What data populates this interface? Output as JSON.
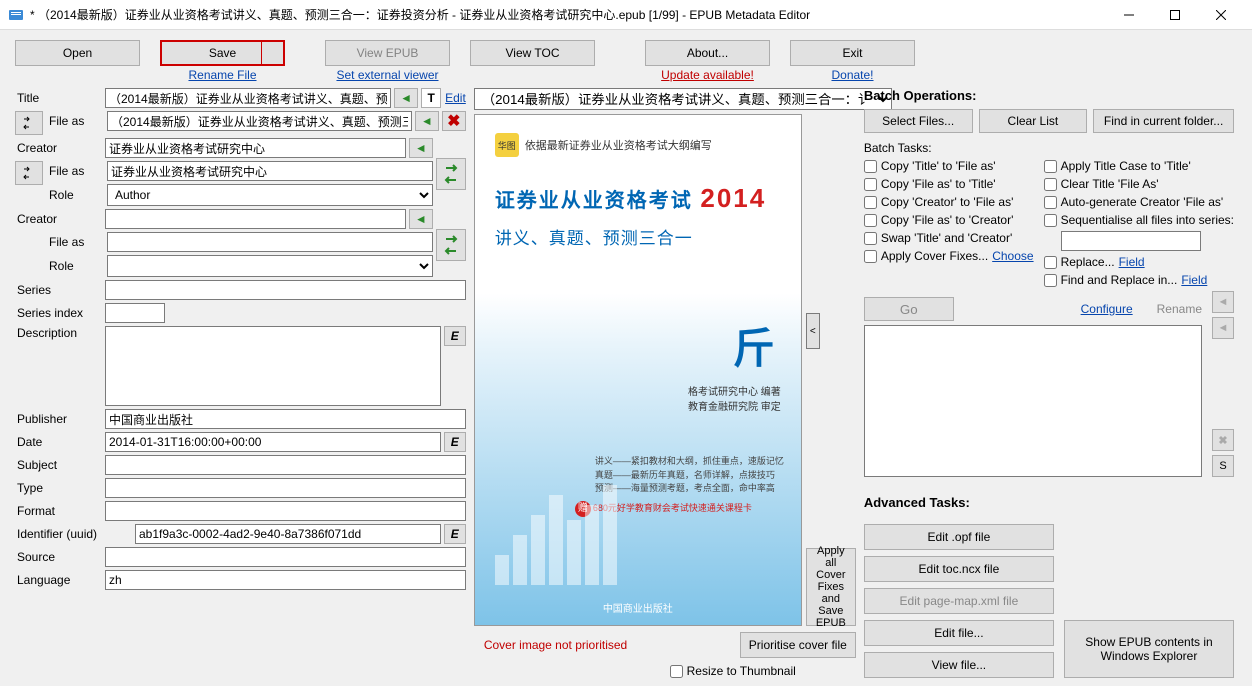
{
  "window": {
    "title": "* （2014最新版）证券业从业资格考试讲义、真题、预测三合一：证券投资分析 - 证券业从业资格考试研究中心.epub [1/99] - EPUB Metadata Editor"
  },
  "toolbar": {
    "open": "Open",
    "save": "Save",
    "view_epub": "View EPUB",
    "view_toc": "View TOC",
    "about": "About...",
    "exit": "Exit"
  },
  "links": {
    "rename_file": "Rename File",
    "set_external_viewer": "Set external viewer",
    "update_available": "Update available!",
    "donate": "Donate!",
    "edit": "Edit",
    "configure": "Configure",
    "rename": "Rename",
    "choose": "Choose",
    "field1": "Field",
    "field2": "Field"
  },
  "form": {
    "labels": {
      "title": "Title",
      "file_as": "File as",
      "creator": "Creator",
      "role": "Role",
      "series": "Series",
      "series_index": "Series index",
      "description": "Description",
      "publisher": "Publisher",
      "date": "Date",
      "subject": "Subject",
      "type": "Type",
      "format": "Format",
      "identifier": "Identifier (uuid)",
      "source": "Source",
      "language": "Language"
    },
    "values": {
      "title": "（2014最新版）证券业从业资格考试讲义、真题、预测三合一：证券",
      "title_fileas": "（2014最新版）证券业从业资格考试讲义、真题、预测三",
      "creator1": "证券业从业资格考试研究中心",
      "creator1_fileas": "证券业从业资格考试研究中心",
      "creator1_role": "Author",
      "creator2": "",
      "creator2_fileas": "",
      "creator2_role": "",
      "series": "",
      "series_index": "",
      "description": "",
      "publisher": "中国商业出版社",
      "date": "2014-01-31T16:00:00+00:00",
      "subject": "",
      "type": "",
      "format": "",
      "identifier": "ab1f9a3c-0002-4ad2-9e40-8a7386f071dd",
      "source": "",
      "language": "zh"
    }
  },
  "combo": {
    "value": "（2014最新版）证券业从业资格考试讲义、真题、预测三合一：讠"
  },
  "cover": {
    "brand_text": "依据最新证券业从业资格考试大纲编写",
    "brand_logo": "华图",
    "title_line": "证券业从业资格考试",
    "year": "2014",
    "subtitle": "讲义、真题、预测三合一",
    "big_glyph": "斤",
    "credit1": "格考试研究中心  编著",
    "credit2": "教育金融研究院  审定",
    "feat1": "讲义——紧扣教材和大纲，抓住重点，速版记忆",
    "feat2": "真题——最新历年真题，名师详解，点拨技巧",
    "feat3": "预测——海量预测考题，考点全面，命中率高",
    "gift": "680元好学教育财会考试快速通关课程卡",
    "gift_badge": "赠",
    "publisher": "中国商业出版社",
    "not_prioritised": "Cover image not prioritised",
    "prioritise_btn": "Prioritise cover file",
    "resize_chk": "Resize to Thumbnail",
    "apply_all": "Apply all Cover Fixes and Save EPUB"
  },
  "batch": {
    "heading": "Batch Operations:",
    "select_files": "Select Files...",
    "clear_list": "Clear List",
    "find_folder": "Find in current folder...",
    "tasks_label": "Batch Tasks:",
    "t1": "Copy 'Title' to 'File as'",
    "t2": "Copy 'File as' to 'Title'",
    "t3": "Copy 'Creator' to 'File as'",
    "t4": "Copy 'File as' to 'Creator'",
    "t5": "Swap 'Title' and 'Creator'",
    "t6": "Apply Cover Fixes...",
    "r1": "Apply Title Case to 'Title'",
    "r2": "Clear Title 'File As'",
    "r3": "Auto-generate Creator 'File as'",
    "r4": "Sequentialise all files into series:",
    "r5": "Replace...",
    "r6": "Find and Replace in...",
    "go": "Go"
  },
  "advanced": {
    "heading": "Advanced Tasks:",
    "edit_opf": "Edit .opf file",
    "edit_toc": "Edit toc.ncx file",
    "edit_pagemap": "Edit page-map.xml file",
    "edit_file": "Edit file...",
    "view_file": "View file...",
    "show_contents": "Show EPUB contents in Windows Explorer"
  }
}
